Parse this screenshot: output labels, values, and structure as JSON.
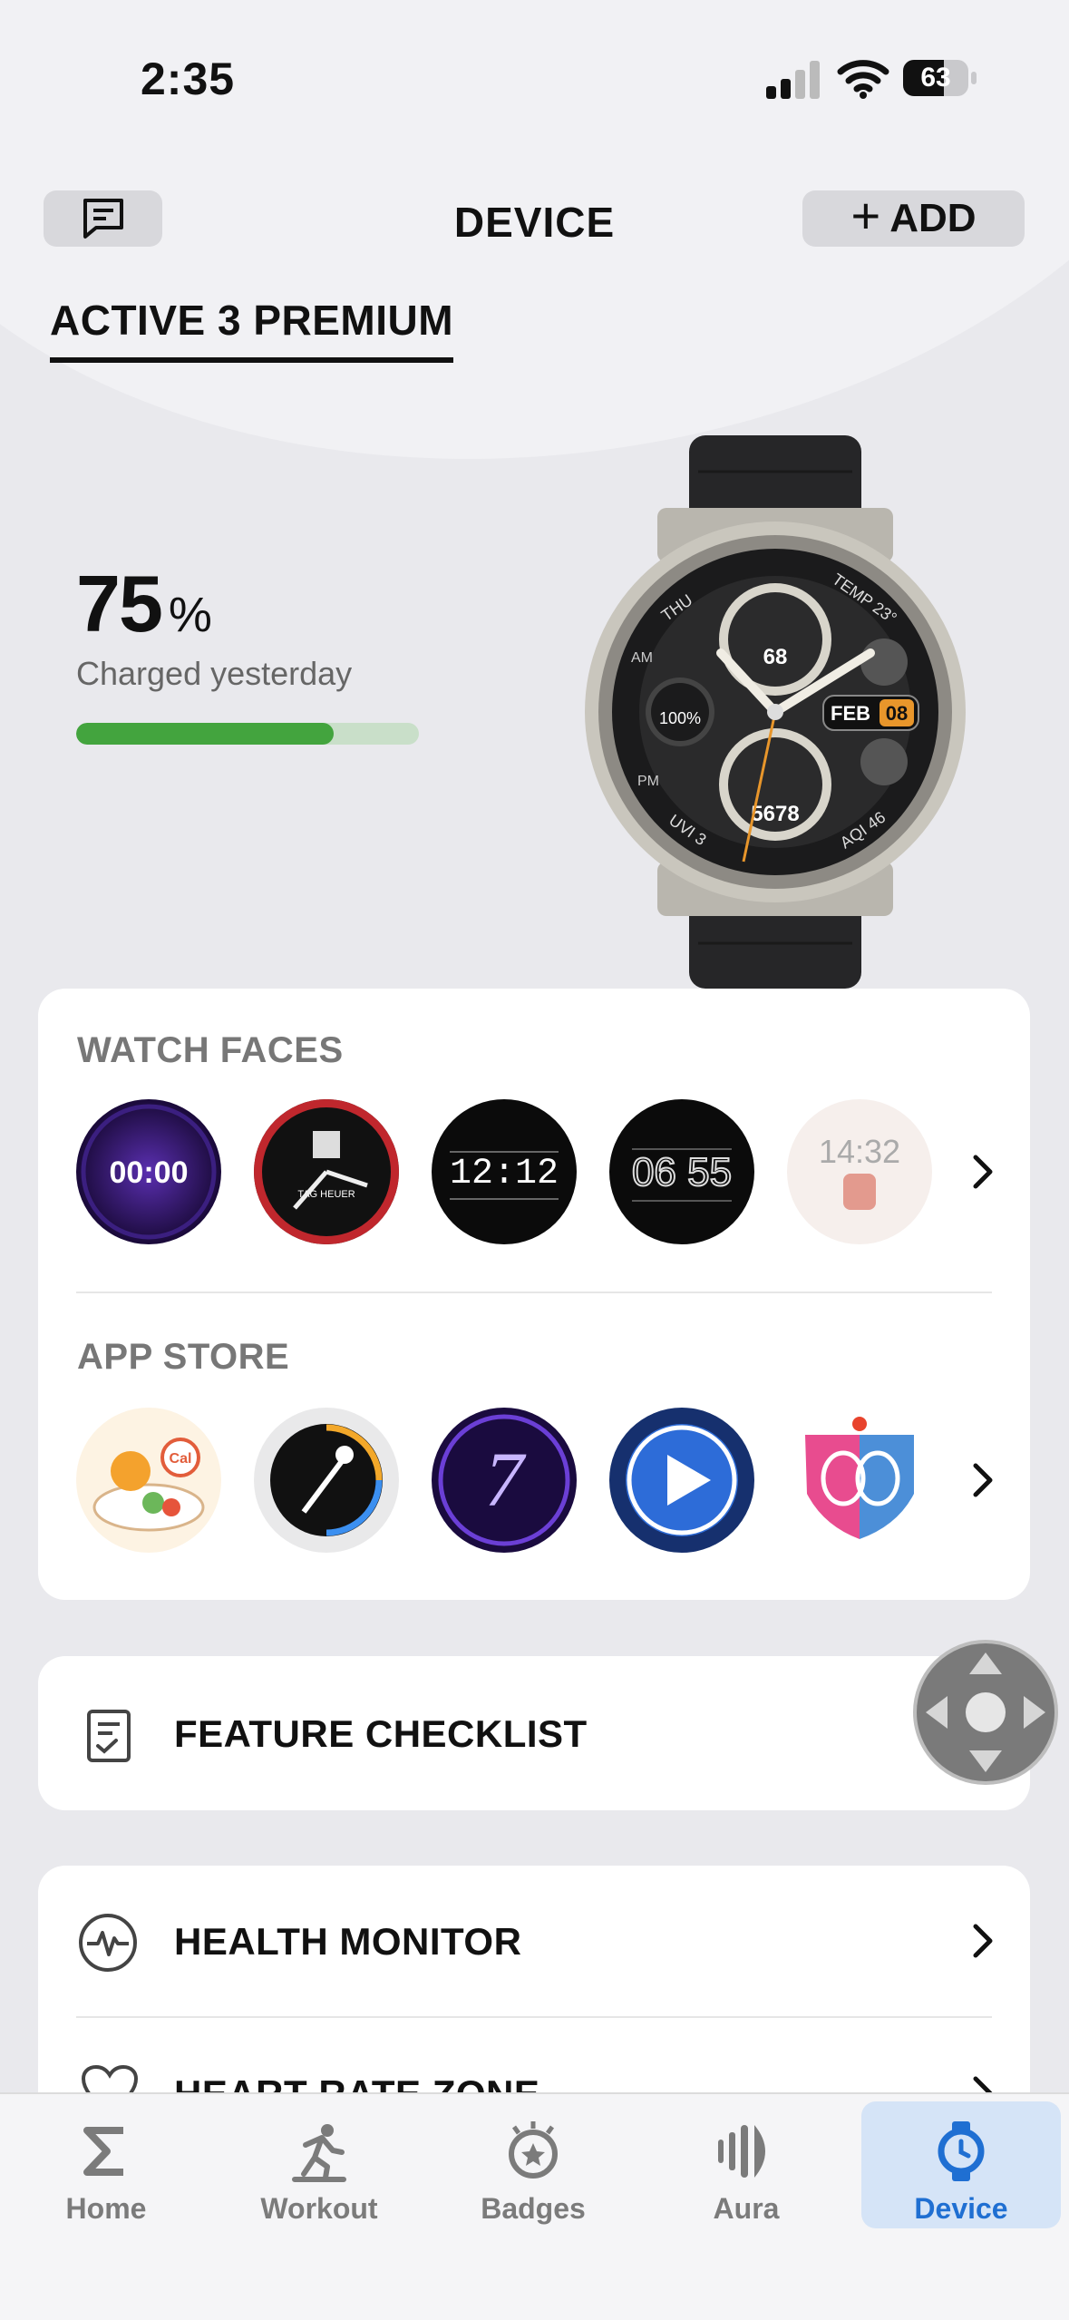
{
  "status_bar": {
    "time": "2:35",
    "battery_level": "63"
  },
  "header": {
    "title": "DEVICE",
    "add_label": "ADD"
  },
  "device": {
    "name": "ACTIVE 3 PREMIUM",
    "battery_value": "75",
    "battery_unit": "%",
    "battery_fraction": 0.75,
    "charged_text": "Charged yesterday",
    "watch_display": {
      "day": "THU",
      "temp": "TEMP 23°",
      "am": "AM",
      "pm": "PM",
      "heart": "68",
      "battery": "100%",
      "month": "FEB",
      "date": "08",
      "steps": "5678",
      "uvi": "UVI 3",
      "aqi": "AQI 46"
    }
  },
  "watch_faces": {
    "title": "WATCH FACES",
    "items": [
      {
        "name": "face-purple-digital",
        "text": "00:00"
      },
      {
        "name": "face-tag-heuer",
        "text": "TAG HEUER"
      },
      {
        "name": "face-lcd-calendar",
        "text": "12:12"
      },
      {
        "name": "face-digital-0655",
        "text": "06 55"
      },
      {
        "name": "face-light-1432",
        "text": "14:32"
      }
    ]
  },
  "app_store": {
    "title": "APP STORE",
    "items": [
      {
        "name": "app-calorie-food",
        "badge": "Cal"
      },
      {
        "name": "app-golf"
      },
      {
        "name": "app-seven",
        "text": "7"
      },
      {
        "name": "app-video-player"
      },
      {
        "name": "app-tennis-badminton"
      }
    ]
  },
  "features": {
    "checklist_label": "FEATURE CHECKLIST"
  },
  "health": {
    "monitor_label": "HEALTH MONITOR",
    "heart_rate_zone_label": "HEART RATE ZONE"
  },
  "tabbar": {
    "tabs": [
      {
        "label": "Home",
        "icon": "sigma-icon"
      },
      {
        "label": "Workout",
        "icon": "runner-icon"
      },
      {
        "label": "Badges",
        "icon": "badge-icon"
      },
      {
        "label": "Aura",
        "icon": "aura-icon"
      },
      {
        "label": "Device",
        "icon": "watch-icon",
        "active": true
      }
    ]
  },
  "colors": {
    "accent_blue": "#1f6fd2",
    "progress_green": "#43a43e",
    "background": "#e9e9ed"
  }
}
